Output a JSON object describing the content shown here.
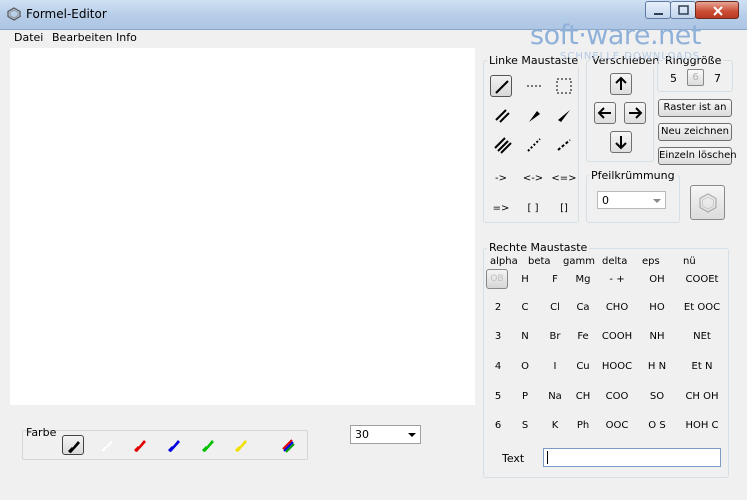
{
  "window": {
    "title": "Formel-Editor"
  },
  "menu": {
    "items": [
      "Datei",
      "Bearbeiten",
      "Info"
    ]
  },
  "watermark": {
    "logo": "soft·ware.net",
    "tagline": "SCHNELLE DOWNLOADS"
  },
  "colors": {
    "label": "Farbe",
    "pens": [
      "black",
      "white",
      "red",
      "blue",
      "green",
      "yellow",
      "multicolor"
    ],
    "hex": [
      "#000000",
      "#ffffff",
      "#e00000",
      "#0000e0",
      "#00c000",
      "#f0e000",
      "#808080"
    ]
  },
  "size": {
    "value": "30"
  },
  "left_mouse": {
    "label": "Linke Maustaste",
    "text_tools": [
      "->",
      "<->",
      "<=>",
      "=>",
      "[ ]",
      "[]"
    ]
  },
  "move": {
    "label": "Verschieben"
  },
  "ring": {
    "label": "Ringgröße",
    "values": [
      "5",
      "6",
      "7"
    ]
  },
  "buttons": {
    "raster": "Raster ist an",
    "redraw": "Neu zeichnen",
    "delete_single": "Einzeln löschen"
  },
  "curve": {
    "label": "Pfeilkrümmung",
    "value": "0"
  },
  "right_mouse": {
    "label": "Rechte Maustaste",
    "greek": [
      "alpha",
      "beta",
      "gamm",
      "delta",
      "eps",
      "nü"
    ],
    "rows": [
      [
        "OB",
        "H",
        "F",
        "Mg",
        "-  +",
        "OH",
        "COOEt"
      ],
      [
        "2",
        "C",
        "Cl",
        "Ca",
        "CHO",
        "HO",
        "Et OOC"
      ],
      [
        "3",
        "N",
        "Br",
        "Fe",
        "COOH",
        "NH",
        "NEt"
      ],
      [
        "4",
        "O",
        "I",
        "Cu",
        "HOOC",
        "H N",
        "Et N"
      ],
      [
        "5",
        "P",
        "Na",
        "CH",
        "COO",
        "SO",
        "CH OH"
      ],
      [
        "6",
        "S",
        "K",
        "Ph",
        "OOC",
        "O S",
        "HOH C"
      ]
    ],
    "text_label": "Text",
    "text_value": ""
  }
}
